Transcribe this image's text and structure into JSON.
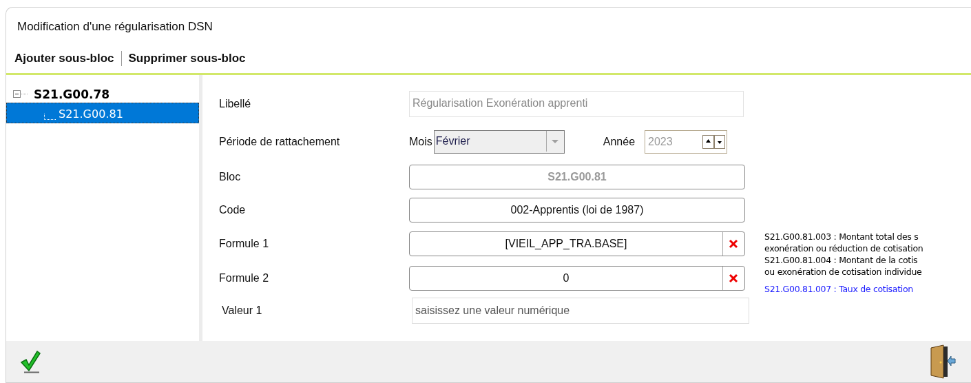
{
  "window": {
    "title": "Modification d'une régularisation DSN"
  },
  "toolbar": [
    {
      "label": "Ajouter sous-bloc"
    },
    {
      "label": "Supprimer sous-bloc"
    }
  ],
  "tree": [
    {
      "label": "S21.G00.78",
      "expanded": true,
      "selected": false,
      "children": [
        {
          "label": "S21.G00.81",
          "selected": true
        }
      ]
    }
  ],
  "form": [
    {
      "kind": "text",
      "label": "Libellé",
      "value": "Régularisation Exonération apprenti",
      "disabled": true
    },
    {
      "kind": "period",
      "label": "Période de  rattachement",
      "month_label": "Mois",
      "month": "Février",
      "year_label": "Année",
      "year": "2023"
    },
    {
      "kind": "box",
      "label": "Bloc",
      "value": "S21.G00.81",
      "disabled": true
    },
    {
      "kind": "box",
      "label": "Code",
      "value": "002-Apprentis (loi de 1987)",
      "disabled": false
    },
    {
      "kind": "formula",
      "label": "Formule 1",
      "value": "[VIEIL_APP_TRA.BASE]"
    },
    {
      "kind": "formula",
      "label": "Formule 2",
      "value": "0"
    },
    {
      "kind": "input",
      "label": "Valeur 1",
      "placeholder": "saisissez une valeur numérique"
    }
  ],
  "help": [
    {
      "text": "S21.G00.81.003 : Montant total des s",
      "color": "#000000"
    },
    {
      "text": "exonération ou réduction de cotisation",
      "color": "#000000"
    },
    {
      "text": "S21.G00.81.004 : Montant de la cotis",
      "color": "#000000"
    },
    {
      "text": "ou exonération de cotisation individue",
      "color": "#000000"
    },
    {
      "text": "S21.G00.81.007 : Taux de cotisation",
      "color": "#1a1aff"
    }
  ]
}
